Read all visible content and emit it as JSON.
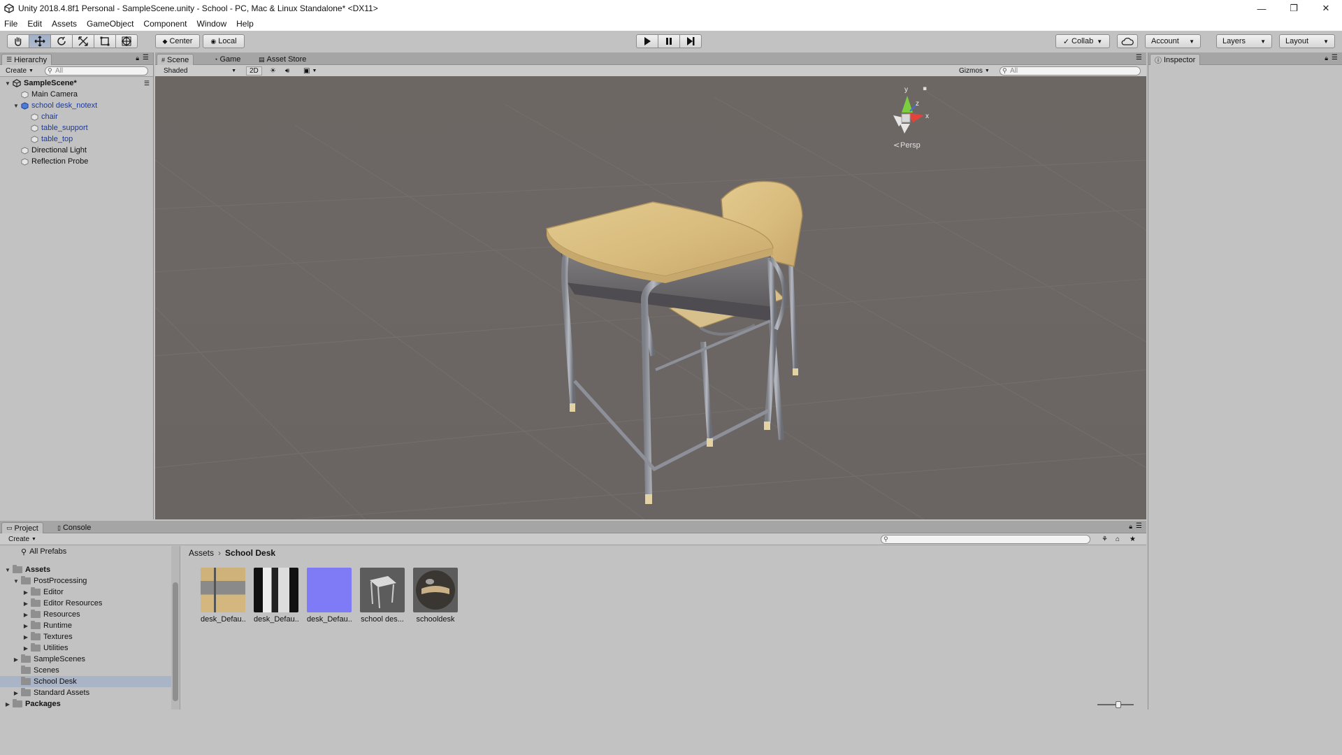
{
  "window": {
    "title": "Unity 2018.4.8f1 Personal - SampleScene.unity - School - PC, Mac & Linux Standalone* <DX11>",
    "controls": [
      "—",
      "❐",
      "✕"
    ]
  },
  "menu": [
    "File",
    "Edit",
    "Assets",
    "GameObject",
    "Component",
    "Window",
    "Help"
  ],
  "toolbar": {
    "pivot_label": "Center",
    "space_label": "Local",
    "collab_label": "Collab",
    "account_label": "Account",
    "layers_label": "Layers",
    "layout_label": "Layout"
  },
  "hierarchy": {
    "tab_label": "Hierarchy",
    "create_label": "Create",
    "search_placeholder": "All",
    "scene_name": "SampleScene*",
    "items": [
      {
        "label": "Main Camera"
      },
      {
        "label": "school desk_notext"
      },
      {
        "label": "chair"
      },
      {
        "label": "table_support"
      },
      {
        "label": "table_top"
      },
      {
        "label": "Directional Light"
      },
      {
        "label": "Reflection Probe"
      }
    ]
  },
  "scene": {
    "tabs": [
      "Scene",
      "Game",
      "Asset Store"
    ],
    "shading_mode": "Shaded",
    "mode_2d": "2D",
    "gizmos_label": "Gizmos",
    "search_placeholder": "All",
    "projection_label": "Persp",
    "axis_labels": {
      "y": "y",
      "z": "z",
      "x": "x"
    }
  },
  "inspector": {
    "tab_label": "Inspector"
  },
  "project": {
    "tabs": [
      "Project",
      "Console"
    ],
    "create_label": "Create",
    "tree": [
      {
        "label": "All Prefabs"
      },
      {
        "label": "Assets"
      },
      {
        "label": "PostProcessing"
      },
      {
        "label": "Editor"
      },
      {
        "label": "Editor Resources"
      },
      {
        "label": "Resources"
      },
      {
        "label": "Runtime"
      },
      {
        "label": "Textures"
      },
      {
        "label": "Utilities"
      },
      {
        "label": "SampleScenes"
      },
      {
        "label": "Scenes"
      },
      {
        "label": "School Desk"
      },
      {
        "label": "Standard Assets"
      },
      {
        "label": "Packages"
      }
    ],
    "breadcrumb": [
      "Assets",
      "School Desk"
    ],
    "assets": [
      {
        "label": "desk_Defau..."
      },
      {
        "label": "desk_Defau..."
      },
      {
        "label": "desk_Defau..."
      },
      {
        "label": "school des..."
      },
      {
        "label": "schooldesk"
      }
    ]
  }
}
